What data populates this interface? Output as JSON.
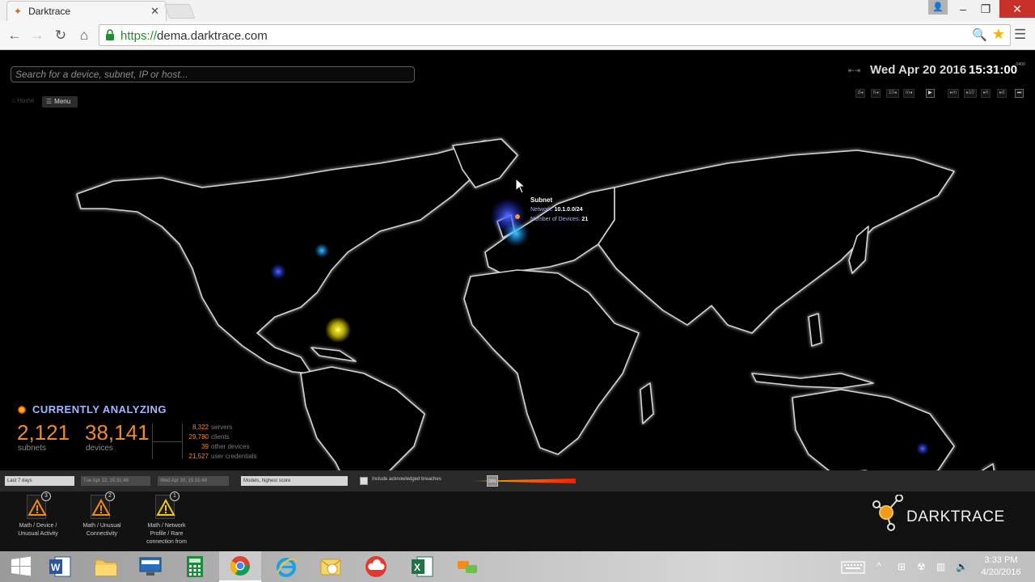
{
  "browser": {
    "tab_title": "Darktrace",
    "url_protocol": "https://",
    "url_host": "dema.darktrace.com"
  },
  "app": {
    "search_placeholder": "Search for a device, subnet, IP or host...",
    "home_label": "Home",
    "menu_label": "Menu",
    "date": "Wed Apr 20 2016",
    "time": "15:31:00",
    "timezone": "-0400",
    "time_controls": [
      "d",
      "h",
      "10",
      "m",
      "▶",
      "m",
      "10",
      "h",
      "d",
      "⏭"
    ],
    "tooltip": {
      "title": "Subnet",
      "network_label": "Network:",
      "network_value": "10.1.0.0/24",
      "devices_label": "Number of Devices:",
      "devices_value": "21"
    },
    "analyzing": {
      "heading": "CURRENTLY ANALYZING",
      "subnets_value": "2,121",
      "subnets_label": "subnets",
      "devices_value": "38,141",
      "devices_label": "devices",
      "breakdown": [
        {
          "value": "8,322",
          "label": "servers"
        },
        {
          "value": "29,780",
          "label": "clients"
        },
        {
          "value": "39",
          "label": "other devices"
        },
        {
          "value": "21,527",
          "label": "user credentials"
        }
      ]
    }
  },
  "filters": {
    "range": "Last 7 days",
    "start": "Tue Apr 12, 15:31:48",
    "end": "Wed Apr 20, 15:31:48",
    "sort": "Models, highest score",
    "include_ack_label": "Include acknowledged breaches",
    "threshold_label": "20%",
    "threshold_value": 0.2
  },
  "breaches": [
    {
      "count": "3",
      "name_line1": "Math / Device /",
      "name_line2": "Unusual Activity",
      "name_line3": ""
    },
    {
      "count": "2",
      "name_line1": "Math / Unusual",
      "name_line2": "Connectivity",
      "name_line3": ""
    },
    {
      "count": "1",
      "name_line1": "Math / Network",
      "name_line2": "Profile / Rare",
      "name_line3": "connection from"
    }
  ],
  "brand": {
    "logo_text": "DARKTRACE"
  },
  "taskbar": {
    "time": "3:33 PM",
    "date": "4/20/2016",
    "apps": [
      "start-icon",
      "word-icon",
      "file-explorer-icon",
      "lenovo-icon",
      "calculator-icon",
      "chrome-icon",
      "ie-icon",
      "outlook-icon",
      "cloud-icon",
      "excel-icon",
      "chat-icon"
    ]
  },
  "colors": {
    "accent_orange": "#ef8a2a",
    "heading_blue": "#a6b6ff",
    "map_outline": "#d0d0d0"
  }
}
